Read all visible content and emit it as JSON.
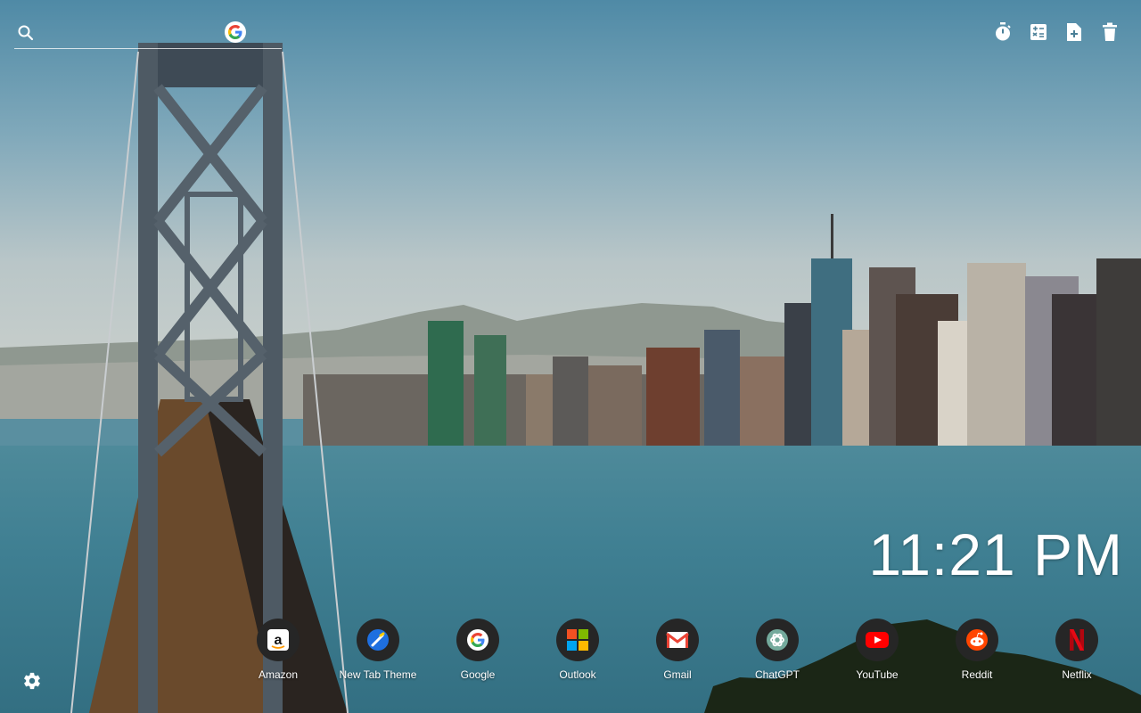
{
  "search": {
    "placeholder": "",
    "engine_icon": "google-g-icon"
  },
  "toolbar": {
    "items": [
      {
        "name": "timer",
        "icon": "stopwatch-icon"
      },
      {
        "name": "calculator",
        "icon": "calculator-icon"
      },
      {
        "name": "add-note",
        "icon": "file-plus-icon"
      },
      {
        "name": "delete",
        "icon": "trash-icon"
      }
    ]
  },
  "clock": {
    "time": "11:21 PM"
  },
  "shortcuts": [
    {
      "label": "Amazon",
      "icon": "amazon-icon"
    },
    {
      "label": "New Tab Theme",
      "icon": "new-tab-theme-icon"
    },
    {
      "label": "Google",
      "icon": "google-icon"
    },
    {
      "label": "Outlook",
      "icon": "microsoft-icon"
    },
    {
      "label": "Gmail",
      "icon": "gmail-icon"
    },
    {
      "label": "ChatGPT",
      "icon": "chatgpt-icon"
    },
    {
      "label": "YouTube",
      "icon": "youtube-icon"
    },
    {
      "label": "Reddit",
      "icon": "reddit-icon"
    },
    {
      "label": "Netflix",
      "icon": "netflix-icon"
    }
  ],
  "settings": {
    "icon": "gear-icon"
  },
  "colors": {
    "shortcut_bg": "#262626",
    "youtube_red": "#ff0000",
    "netflix_red": "#e50914",
    "reddit_orange": "#ff4500",
    "new_tab_blue": "#1e6fe0"
  }
}
